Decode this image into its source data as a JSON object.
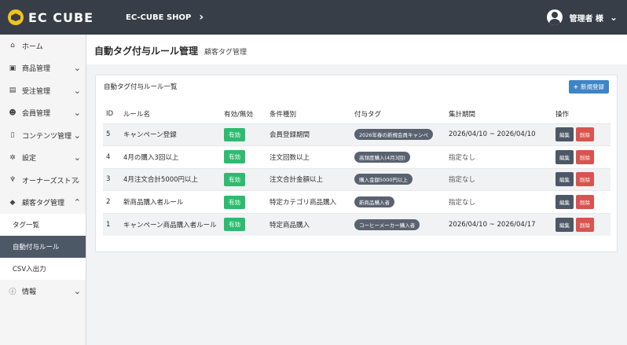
{
  "header": {
    "logo_text": "EC CUBE",
    "shop_name": "EC-CUBE SHOP",
    "user_name": "管理者 様"
  },
  "sidebar": {
    "items": [
      {
        "label": "ホーム",
        "icon": "home-icon",
        "glyph": "⌂",
        "chevron": false
      },
      {
        "label": "商品管理",
        "icon": "box-icon",
        "glyph": "▣",
        "chevron": true
      },
      {
        "label": "受注管理",
        "icon": "cart-icon",
        "glyph": "▤",
        "chevron": true
      },
      {
        "label": "会員管理",
        "icon": "users-icon",
        "glyph": "☻",
        "chevron": true
      },
      {
        "label": "コンテンツ管理",
        "icon": "file-icon",
        "glyph": "▯",
        "chevron": true
      },
      {
        "label": "設定",
        "icon": "gear-icon",
        "glyph": "✲",
        "chevron": true
      },
      {
        "label": "オーナーズストア",
        "icon": "plug-icon",
        "glyph": "♆",
        "chevron": true
      },
      {
        "label": "顧客タグ管理",
        "icon": "tags-icon",
        "glyph": "◆",
        "chevron": true,
        "expanded": true
      }
    ],
    "sub_items": [
      "タグ一覧",
      "自動付与ルール",
      "CSV入出力"
    ],
    "last_item": {
      "label": "情報",
      "icon": "info-icon",
      "glyph": "ⓘ"
    }
  },
  "page": {
    "title": "自動タグ付与ルール管理",
    "subtitle": "顧客タグ管理"
  },
  "card": {
    "title": "自動タグ付与ルール一覧",
    "new_button": "新規登録",
    "columns": [
      "ID",
      "ルール名",
      "有効/無効",
      "条件種別",
      "付与タグ",
      "集計期間",
      "操作"
    ],
    "rows": [
      {
        "id": "5",
        "name": "キャンペーン登録",
        "status": "有効",
        "condition": "会員登録期間",
        "tag": "2026年春の新規会員キャンペ",
        "period": "2026/04/10 ~ 2026/04/10"
      },
      {
        "id": "4",
        "name": "4月の購入3回以上",
        "status": "有効",
        "condition": "注文回数以上",
        "tag": "高頻度購入(4月3回)",
        "period": "指定なし"
      },
      {
        "id": "3",
        "name": "4月注文合計5000円以上",
        "status": "有効",
        "condition": "注文合計金額以上",
        "tag": "購入金額5000円以上",
        "period": "指定なし"
      },
      {
        "id": "2",
        "name": "新商品購入者ルール",
        "status": "有効",
        "condition": "特定カテゴリ商品購入",
        "tag": "新商品購入者",
        "period": "指定なし"
      },
      {
        "id": "1",
        "name": "キャンペーン商品購入者ルール",
        "status": "有効",
        "condition": "特定商品購入",
        "tag": "コーヒーメーカー購入者",
        "period": "2026/04/10 ~ 2026/04/17"
      }
    ],
    "edit_label": "編集",
    "delete_label": "削除"
  }
}
